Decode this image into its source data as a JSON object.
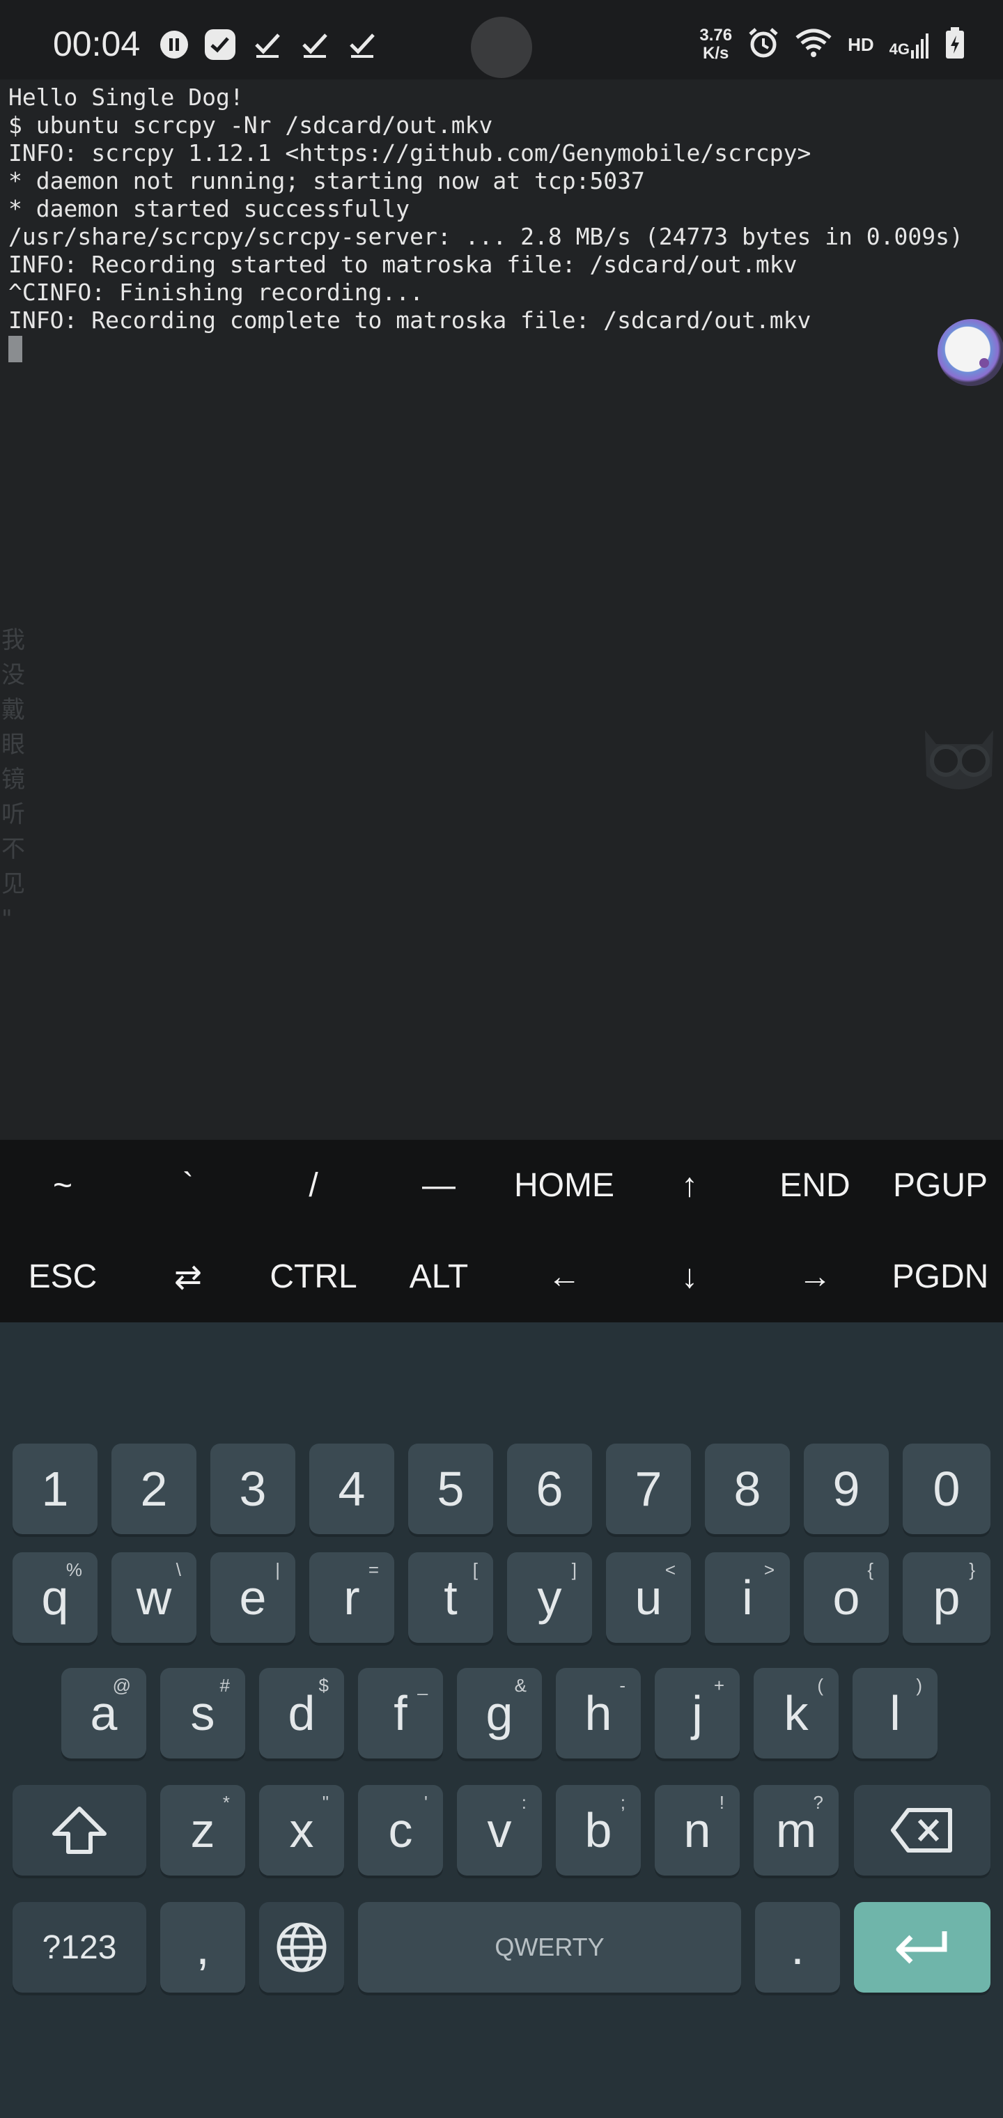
{
  "status_bar": {
    "time": "00:04",
    "net_speed_value": "3.76",
    "net_speed_unit": "K/s",
    "hd_label": "HD",
    "network_type": "4G",
    "icons": [
      "pause-circle-icon",
      "app-notification-icon",
      "check-icon",
      "check-icon",
      "check-icon",
      "alarm-icon",
      "wifi-icon",
      "signal-icon",
      "battery-icon"
    ]
  },
  "terminal": {
    "lines": [
      "Hello Single Dog!",
      "$ ubuntu scrcpy -Nr /sdcard/out.mkv",
      "INFO: scrcpy 1.12.1 <https://github.com/Genymobile/scrcpy>",
      "* daemon not running; starting now at tcp:5037",
      "* daemon started successfully",
      "/usr/share/scrcpy/scrcpy-server: ... 2.8 MB/s (24773 bytes in 0.009s)",
      "INFO: Recording started to matroska file: /sdcard/out.mkv",
      "^CINFO: Finishing recording...",
      "INFO: Recording complete to matroska file: /sdcard/out.mkv"
    ],
    "watermark_vertical": [
      "我",
      "没",
      "戴",
      "眼",
      "镜",
      "听",
      "不",
      "见",
      "\""
    ]
  },
  "extra_keys": {
    "row1": [
      "~",
      "`",
      "/",
      "—",
      "HOME",
      "↑",
      "END",
      "PGUP"
    ],
    "row2": [
      "ESC",
      "⇄",
      "CTRL",
      "ALT",
      "←",
      "↓",
      "→",
      "PGDN"
    ]
  },
  "keyboard": {
    "numbers": [
      "1",
      "2",
      "3",
      "4",
      "5",
      "6",
      "7",
      "8",
      "9",
      "0"
    ],
    "row_q": [
      {
        "key": "q",
        "hint": "%"
      },
      {
        "key": "w",
        "hint": "\\"
      },
      {
        "key": "e",
        "hint": "|"
      },
      {
        "key": "r",
        "hint": "="
      },
      {
        "key": "t",
        "hint": "["
      },
      {
        "key": "y",
        "hint": "]"
      },
      {
        "key": "u",
        "hint": "<"
      },
      {
        "key": "i",
        "hint": ">"
      },
      {
        "key": "o",
        "hint": "{"
      },
      {
        "key": "p",
        "hint": "}"
      }
    ],
    "row_a": [
      {
        "key": "a",
        "hint": "@"
      },
      {
        "key": "s",
        "hint": "#"
      },
      {
        "key": "d",
        "hint": "$"
      },
      {
        "key": "f",
        "hint": "_"
      },
      {
        "key": "g",
        "hint": "&"
      },
      {
        "key": "h",
        "hint": "-"
      },
      {
        "key": "j",
        "hint": "+"
      },
      {
        "key": "k",
        "hint": "("
      },
      {
        "key": "l",
        "hint": ")"
      }
    ],
    "row_z": [
      {
        "key": "z",
        "hint": "*"
      },
      {
        "key": "x",
        "hint": "\""
      },
      {
        "key": "c",
        "hint": "'"
      },
      {
        "key": "v",
        "hint": ":"
      },
      {
        "key": "b",
        "hint": ";"
      },
      {
        "key": "n",
        "hint": "!"
      },
      {
        "key": "m",
        "hint": "?"
      }
    ],
    "symbols_label": "?123",
    "comma": ",",
    "space_label": "QWERTY",
    "period": ".",
    "icons": [
      "shift-icon",
      "backspace-icon",
      "globe-icon",
      "enter-icon"
    ],
    "enter_color": "#6fb5aa"
  }
}
